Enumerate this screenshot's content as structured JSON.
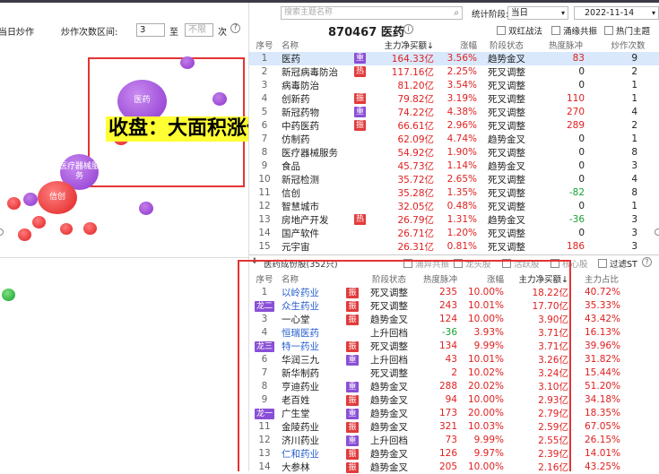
{
  "left": {
    "prev_day_label": "当日炒作",
    "count_label": "炒作次数区间:",
    "min_value": "3",
    "to_label": "至",
    "max_placeholder": "不限",
    "unit": "次",
    "caption": "收盘：大面积涨停",
    "bubbles": [
      {
        "label": "医药"
      },
      {
        "label": "医疗器械服务"
      },
      {
        "label": "信创"
      }
    ]
  },
  "right": {
    "search_placeholder": "搜索主题名称",
    "stat_label": "统计阶段:",
    "stat_value": "当日",
    "date": "2022-11-14",
    "theme_code": "870467",
    "theme_name": "医药",
    "filters": [
      "双红战法",
      "涌缘共振",
      "热门主题"
    ],
    "table1_headers": [
      "序号",
      "名称",
      "主力净买额↓",
      "涨幅",
      "阶段状态",
      "热度脉冲",
      "炒作次数"
    ],
    "table1_rows": [
      {
        "idx": "1",
        "name": "医药",
        "tag": "重",
        "amount": "164.33亿",
        "pct": "3.56%",
        "state": "趋势金叉",
        "heat": "83",
        "times": "9"
      },
      {
        "idx": "2",
        "name": "新冠病毒防治",
        "tag": "热",
        "amount": "117.16亿",
        "pct": "2.25%",
        "state": "死叉调整",
        "heat": "0",
        "times": "2"
      },
      {
        "idx": "3",
        "name": "病毒防治",
        "tag": "",
        "amount": "81.20亿",
        "pct": "3.54%",
        "state": "死叉调整",
        "heat": "0",
        "times": "1"
      },
      {
        "idx": "4",
        "name": "创新药",
        "tag": "振",
        "amount": "79.82亿",
        "pct": "3.19%",
        "state": "死叉调整",
        "heat": "110",
        "times": "1"
      },
      {
        "idx": "5",
        "name": "新冠药物",
        "tag": "重",
        "amount": "74.22亿",
        "pct": "4.38%",
        "state": "死叉调整",
        "heat": "270",
        "times": "4"
      },
      {
        "idx": "6",
        "name": "中药医药",
        "tag": "振",
        "amount": "66.61亿",
        "pct": "2.96%",
        "state": "死叉调整",
        "heat": "289",
        "times": "2"
      },
      {
        "idx": "7",
        "name": "仿制药",
        "tag": "",
        "amount": "62.09亿",
        "pct": "4.74%",
        "state": "趋势金叉",
        "heat": "0",
        "times": "1"
      },
      {
        "idx": "8",
        "name": "医疗器械服务",
        "tag": "",
        "amount": "54.92亿",
        "pct": "1.90%",
        "state": "死叉调整",
        "heat": "0",
        "times": "8"
      },
      {
        "idx": "9",
        "name": "食品",
        "tag": "",
        "amount": "45.73亿",
        "pct": "1.14%",
        "state": "趋势金叉",
        "heat": "0",
        "times": "3"
      },
      {
        "idx": "10",
        "name": "新冠检测",
        "tag": "",
        "amount": "35.72亿",
        "pct": "2.65%",
        "state": "死叉调整",
        "heat": "0",
        "times": "4"
      },
      {
        "idx": "11",
        "name": "信创",
        "tag": "",
        "amount": "35.28亿",
        "pct": "1.35%",
        "state": "死叉调整",
        "heat": "-82",
        "times": "8"
      },
      {
        "idx": "12",
        "name": "智慧城市",
        "tag": "",
        "amount": "32.05亿",
        "pct": "0.48%",
        "state": "死叉调整",
        "heat": "0",
        "times": "1"
      },
      {
        "idx": "13",
        "name": "房地产开发",
        "tag": "热",
        "amount": "26.79亿",
        "pct": "1.31%",
        "state": "趋势金叉",
        "heat": "-36",
        "times": "3"
      },
      {
        "idx": "14",
        "name": "国产软件",
        "tag": "",
        "amount": "26.71亿",
        "pct": "1.20%",
        "state": "死叉调整",
        "heat": "0",
        "times": "3"
      },
      {
        "idx": "15",
        "name": "元宇宙",
        "tag": "",
        "amount": "26.31亿",
        "pct": "0.81%",
        "state": "死叉调整",
        "heat": "186",
        "times": "3"
      }
    ],
    "section2_title": "医药成份股(352只)",
    "section2_filters": [
      "涌异共振",
      "龙头股",
      "活跃股",
      "核心股",
      "过滤ST"
    ],
    "table2_headers": [
      "序号",
      "名称",
      "阶段状态",
      "热度脉冲",
      "涨幅",
      "主力净买额↓",
      "主力占比"
    ],
    "table2_rows": [
      {
        "idx": "1",
        "badge": "",
        "name": "以岭药业",
        "tag": "振",
        "state": "死叉调整",
        "heat": "235",
        "pct": "10.00%",
        "amount": "18.22亿",
        "ratio": "40.72%",
        "blue": true
      },
      {
        "idx": "龙二",
        "badge": "p",
        "name": "众生药业",
        "tag": "振",
        "state": "死叉调整",
        "heat": "243",
        "pct": "10.01%",
        "amount": "17.70亿",
        "ratio": "35.33%",
        "blue": true
      },
      {
        "idx": "3",
        "badge": "",
        "name": "一心堂",
        "tag": "振",
        "state": "趋势金叉",
        "heat": "124",
        "pct": "10.00%",
        "amount": "3.90亿",
        "ratio": "43.42%",
        "blue": false
      },
      {
        "idx": "4",
        "badge": "",
        "name": "恒瑞医药",
        "tag": "",
        "state": "上升回档",
        "heat": "-36",
        "pct": "3.93%",
        "amount": "3.71亿",
        "ratio": "16.13%",
        "blue": true
      },
      {
        "idx": "龙三",
        "badge": "p",
        "name": "特一药业",
        "tag": "振",
        "state": "死叉调整",
        "heat": "134",
        "pct": "9.99%",
        "amount": "3.71亿",
        "ratio": "39.96%",
        "blue": true
      },
      {
        "idx": "6",
        "badge": "",
        "name": "华润三九",
        "tag": "重",
        "state": "上升回档",
        "heat": "43",
        "pct": "10.01%",
        "amount": "3.26亿",
        "ratio": "31.82%",
        "blue": false
      },
      {
        "idx": "7",
        "badge": "",
        "name": "新华制药",
        "tag": "",
        "state": "死叉调整",
        "heat": "2",
        "pct": "10.02%",
        "amount": "3.24亿",
        "ratio": "15.44%",
        "blue": false
      },
      {
        "idx": "8",
        "badge": "",
        "name": "亨迪药业",
        "tag": "重",
        "state": "趋势金叉",
        "heat": "288",
        "pct": "20.02%",
        "amount": "3.10亿",
        "ratio": "51.20%",
        "blue": false
      },
      {
        "idx": "9",
        "badge": "",
        "name": "老百姓",
        "tag": "振",
        "state": "趋势金叉",
        "heat": "94",
        "pct": "10.00%",
        "amount": "2.93亿",
        "ratio": "34.18%",
        "blue": false
      },
      {
        "idx": "龙一",
        "badge": "p",
        "name": "广生堂",
        "tag": "重",
        "state": "趋势金叉",
        "heat": "173",
        "pct": "20.00%",
        "amount": "2.79亿",
        "ratio": "18.35%",
        "blue": false
      },
      {
        "idx": "11",
        "badge": "",
        "name": "金陵药业",
        "tag": "振",
        "state": "趋势金叉",
        "heat": "321",
        "pct": "10.03%",
        "amount": "2.59亿",
        "ratio": "67.05%",
        "blue": false
      },
      {
        "idx": "12",
        "badge": "",
        "name": "济川药业",
        "tag": "重",
        "state": "上升回档",
        "heat": "73",
        "pct": "9.99%",
        "amount": "2.55亿",
        "ratio": "26.15%",
        "blue": false
      },
      {
        "idx": "13",
        "badge": "",
        "name": "仁和药业",
        "tag": "振",
        "state": "趋势金叉",
        "heat": "126",
        "pct": "9.97%",
        "amount": "2.39亿",
        "ratio": "14.01%",
        "blue": true
      },
      {
        "idx": "14",
        "badge": "",
        "name": "大参林",
        "tag": "振",
        "state": "趋势金叉",
        "heat": "205",
        "pct": "10.00%",
        "amount": "2.16亿",
        "ratio": "43.25%",
        "blue": false
      }
    ],
    "colors": {
      "up": "#e02020",
      "down": "#16a032",
      "tag_red": "#e23b3b",
      "tag_purple": "#8a4fd6",
      "selected": "#d9e8fb"
    }
  }
}
